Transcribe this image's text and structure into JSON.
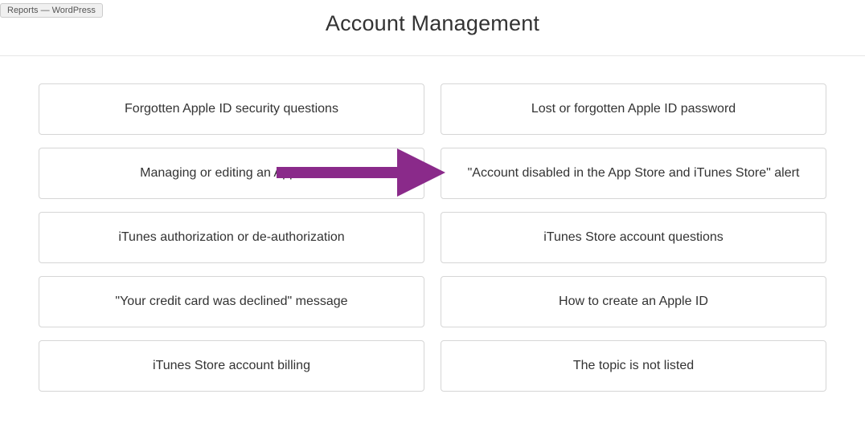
{
  "browser_tab": "Reports — WordPress",
  "title": "Account Management",
  "options": [
    {
      "label": "Forgotten Apple ID security questions"
    },
    {
      "label": "Lost or forgotten Apple ID password"
    },
    {
      "label": "Managing or editing an Apple ID"
    },
    {
      "label": "\"Account disabled in the App Store and iTunes Store\" alert"
    },
    {
      "label": "iTunes authorization or de-authorization"
    },
    {
      "label": "iTunes Store account questions"
    },
    {
      "label": "\"Your credit card was declined\" message"
    },
    {
      "label": "How to create an Apple ID"
    },
    {
      "label": "iTunes Store account billing"
    },
    {
      "label": "The topic is not listed"
    }
  ],
  "annotation": {
    "arrow_color": "#8a2a8a"
  }
}
